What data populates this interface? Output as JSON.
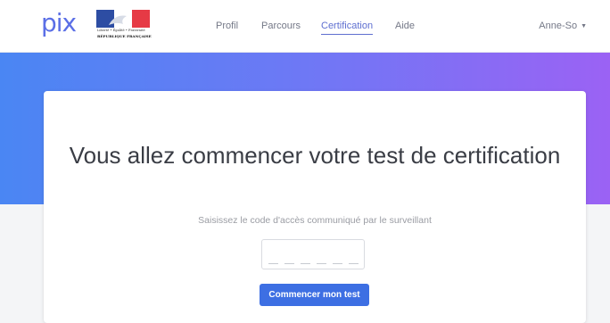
{
  "header": {
    "logo_text": "pix",
    "gov_logo": {
      "motto": "Liberté • Égalité • Fraternité",
      "name": "RÉPUBLIQUE FRANÇAISE"
    },
    "nav": [
      {
        "label": "Profil",
        "active": false
      },
      {
        "label": "Parcours",
        "active": false
      },
      {
        "label": "Certification",
        "active": true
      },
      {
        "label": "Aide",
        "active": false
      }
    ],
    "user_name": "Anne-So",
    "user_caret": "▼"
  },
  "main": {
    "title": "Vous allez commencer votre test de certification",
    "instructions": "Saisissez le code d'accès communiqué par le surveillant",
    "access_code": {
      "value": "",
      "slots": 6
    },
    "start_button_label": "Commencer mon test"
  },
  "colors": {
    "logo": "#5b6fe6",
    "banner_gradient": [
      "#4a86f3",
      "#9b62f4"
    ],
    "primary_button": "#3d6fe3",
    "active_nav": "#5e6fd0"
  }
}
